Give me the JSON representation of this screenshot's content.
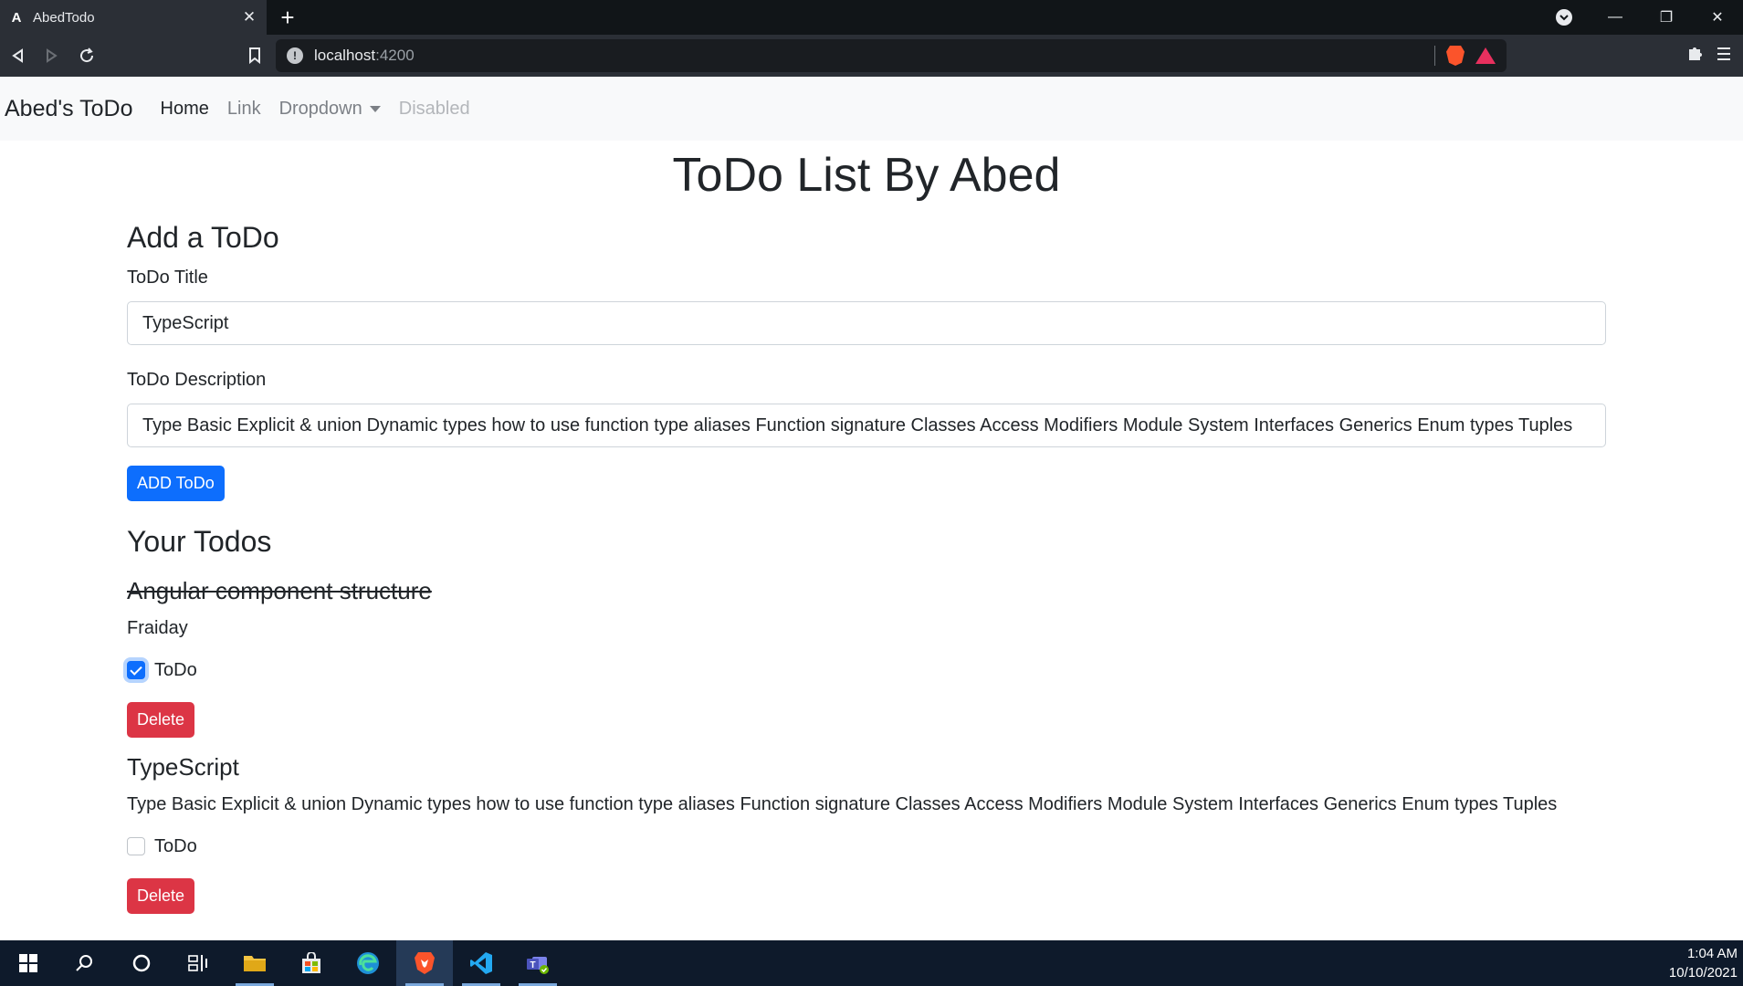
{
  "browser": {
    "tab_title": "AbedTodo",
    "url_host": "localhost",
    "url_port": ":4200"
  },
  "navbar": {
    "brand": "Abed's ToDo",
    "links": [
      {
        "label": "Home",
        "state": "active"
      },
      {
        "label": "Link",
        "state": "normal"
      },
      {
        "label": "Dropdown",
        "state": "dropdown"
      },
      {
        "label": "Disabled",
        "state": "disabled"
      }
    ]
  },
  "page": {
    "title": "ToDo List By Abed"
  },
  "add_form": {
    "heading": "Add a ToDo",
    "title_label": "ToDo Title",
    "title_value": "TypeScript",
    "desc_label": "ToDo Description",
    "desc_value": "Type Basic Explicit & union Dynamic types how to use function type aliases Function signature Classes Access Modifiers Module System Interfaces Generics Enum types Tuples",
    "submit_label": "ADD ToDo"
  },
  "todos": {
    "heading": "Your Todos",
    "items": [
      {
        "title": "Angular component structure",
        "desc": "Fraiday",
        "checkbox_label": "ToDo",
        "checked": true,
        "delete_label": "Delete"
      },
      {
        "title": "TypeScript",
        "desc": "Type Basic Explicit & union Dynamic types how to use function type aliases Function signature Classes Access Modifiers Module System Interfaces Generics Enum types Tuples",
        "checkbox_label": "ToDo",
        "checked": false,
        "delete_label": "Delete"
      }
    ]
  },
  "taskbar": {
    "time": "1:04 AM",
    "date": "10/10/2021"
  },
  "colors": {
    "primary": "#0d6efd",
    "danger": "#dc3545",
    "navbar_bg": "#f8f9fa",
    "taskbar_bg": "#0e1a2b"
  }
}
